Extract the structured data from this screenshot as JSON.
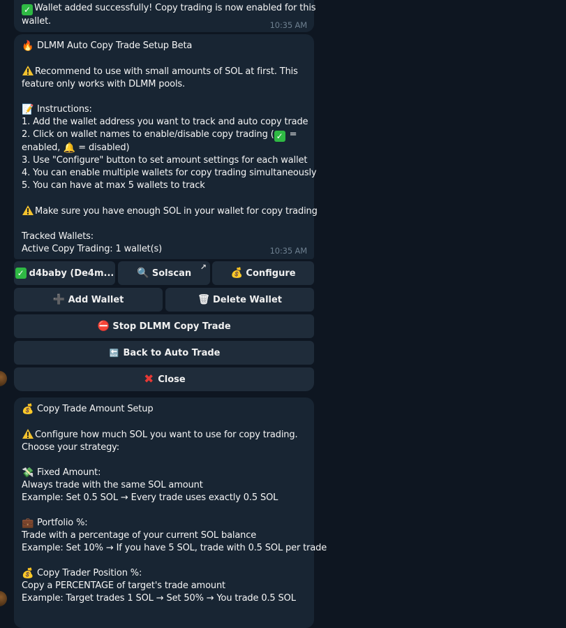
{
  "msg1": {
    "lines": [
      "Wallet added successfully! Copy trading is now enabled for this",
      "wallet."
    ],
    "time": "10:35 AM"
  },
  "msg2": {
    "title": "DLMM Auto Copy Trade Setup Beta",
    "warn1_a": "Recommend to use with small amounts of SOL at first. This",
    "warn1_b": "feature only works with DLMM pools.",
    "instructions_label": "Instructions:",
    "i1": "1. Add the wallet address you want to track and auto copy trade",
    "i2a": "2. Click on wallet names to enable/disable copy trading (",
    "i2b": " =",
    "i2c": "enabled, ",
    "i2d": " = disabled)",
    "i3": "3. Use \"Configure\" button to set amount settings for each wallet",
    "i4": "4. You can enable multiple wallets for copy trading simultaneously",
    "i5": "5. You can have at max 5 wallets to track",
    "warn2": "Make sure you have enough SOL in your wallet for copy trading",
    "tracked": "Tracked Wallets:",
    "active": "Active Copy Trading: 1 wallet(s)",
    "time": "10:35 AM"
  },
  "buttons": {
    "wallet": "d4baby (De4m...",
    "solscan": "Solscan",
    "solscan_ext": "↗",
    "configure": "Configure",
    "add_wallet": "Add Wallet",
    "delete_wallet": "Delete Wallet",
    "stop": "Stop DLMM Copy Trade",
    "back": "Back to Auto Trade",
    "close": "Close"
  },
  "msg3": {
    "title": "Copy Trade Amount Setup",
    "warn_a": "Configure how much SOL you want to use for copy trading.",
    "warn_b": "Choose your strategy:",
    "fixed_title": "Fixed Amount:",
    "fixed_desc": "Always trade with the same SOL amount",
    "fixed_ex": "Example: Set 0.5 SOL → Every trade uses exactly 0.5 SOL",
    "portfolio_title": "Portfolio %:",
    "portfolio_desc": "Trade with a percentage of your current SOL balance",
    "portfolio_ex": "Example: Set 10% → If you have 5 SOL, trade with 0.5 SOL per trade",
    "position_title": "Copy Trader Position %:",
    "position_desc": "Copy a PERCENTAGE of target's trade amount",
    "position_ex": "Example: Target trades 1 SOL → Set 50% → You trade 0.5 SOL"
  },
  "icons": {
    "check": "✓",
    "fire": "🔥",
    "memo": "📝",
    "bell": "🔔",
    "search": "🔍",
    "moneybag": "💰",
    "plus": "➕",
    "trash": "🗑",
    "stop": "⛔",
    "back": "🔙",
    "cross": "✖",
    "money_wings": "💸",
    "briefcase": "💼"
  }
}
